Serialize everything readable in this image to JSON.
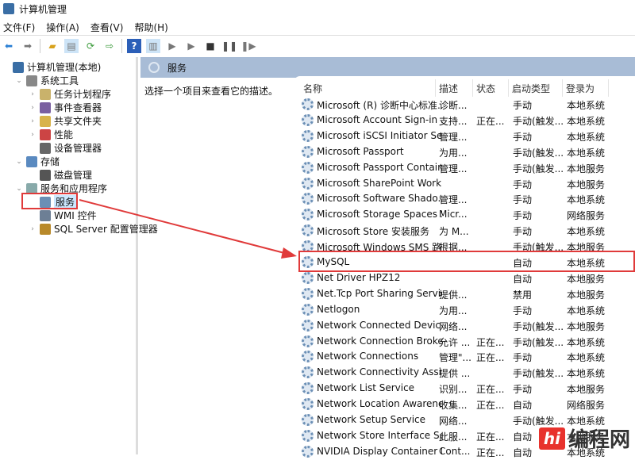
{
  "window": {
    "title": "计算机管理"
  },
  "menu": [
    "文件(F)",
    "操作(A)",
    "查看(V)",
    "帮助(H)"
  ],
  "tree": [
    {
      "label": "计算机管理(本地)",
      "level": 0,
      "expander": "",
      "icon": "computer-icon"
    },
    {
      "label": "系统工具",
      "level": 1,
      "expander": "⌄",
      "icon": "tools-icon"
    },
    {
      "label": "任务计划程序",
      "level": 2,
      "expander": "›",
      "icon": "clock-icon"
    },
    {
      "label": "事件查看器",
      "level": 2,
      "expander": "›",
      "icon": "event-viewer-icon"
    },
    {
      "label": "共享文件夹",
      "level": 2,
      "expander": "›",
      "icon": "shared-folder-icon"
    },
    {
      "label": "性能",
      "level": 2,
      "expander": "›",
      "icon": "performance-icon"
    },
    {
      "label": "设备管理器",
      "level": 2,
      "expander": "",
      "icon": "device-manager-icon"
    },
    {
      "label": "存储",
      "level": 1,
      "expander": "⌄",
      "icon": "storage-icon"
    },
    {
      "label": "磁盘管理",
      "level": 2,
      "expander": "",
      "icon": "disk-icon"
    },
    {
      "label": "服务和应用程序",
      "level": 1,
      "expander": "⌄",
      "icon": "services-apps-icon"
    },
    {
      "label": "服务",
      "level": 2,
      "expander": "",
      "icon": "gear-icon",
      "selected": true
    },
    {
      "label": "WMI 控件",
      "level": 2,
      "expander": "",
      "icon": "wmi-icon"
    },
    {
      "label": "SQL Server 配置管理器",
      "level": 2,
      "expander": "›",
      "icon": "sql-server-icon"
    }
  ],
  "pane": {
    "title": "服务",
    "description": "选择一个项目来查看它的描述。"
  },
  "columns": [
    "名称",
    "描述",
    "状态",
    "启动类型",
    "登录为"
  ],
  "services": [
    [
      "Microsoft (R) 诊断中心标准...",
      "诊断...",
      "",
      "手动",
      "本地系统"
    ],
    [
      "Microsoft Account Sign-in ...",
      "支持...",
      "正在...",
      "手动(触发...",
      "本地系统"
    ],
    [
      "Microsoft iSCSI Initiator Ser...",
      "管理...",
      "",
      "手动",
      "本地系统"
    ],
    [
      "Microsoft Passport",
      "为用...",
      "",
      "手动(触发...",
      "本地系统"
    ],
    [
      "Microsoft Passport Container",
      "管理...",
      "",
      "手动(触发...",
      "本地服务"
    ],
    [
      "Microsoft SharePoint Work...",
      "",
      "",
      "手动",
      "本地服务"
    ],
    [
      "Microsoft Software Shado...",
      "管理...",
      "",
      "手动",
      "本地系统"
    ],
    [
      "Microsoft Storage Spaces S...",
      "Micr...",
      "",
      "手动",
      "网络服务"
    ],
    [
      "Microsoft Store 安装服务",
      "为 M...",
      "",
      "手动",
      "本地系统"
    ],
    [
      "Microsoft Windows SMS 路...",
      "根据...",
      "",
      "手动(触发...",
      "本地服务"
    ],
    [
      "MySQL",
      "",
      "",
      "自动",
      "本地系统"
    ],
    [
      "Net Driver HPZ12",
      "",
      "",
      "自动",
      "本地服务"
    ],
    [
      "Net.Tcp Port Sharing Service",
      "提供...",
      "",
      "禁用",
      "本地服务"
    ],
    [
      "Netlogon",
      "为用...",
      "",
      "手动",
      "本地系统"
    ],
    [
      "Network Connected Devic...",
      "网络...",
      "",
      "手动(触发...",
      "本地服务"
    ],
    [
      "Network Connection Broker",
      "允许 ...",
      "正在...",
      "手动(触发...",
      "本地系统"
    ],
    [
      "Network Connections",
      "管理\"...",
      "正在...",
      "手动",
      "本地系统"
    ],
    [
      "Network Connectivity Assis...",
      "提供 ...",
      "",
      "手动(触发...",
      "本地系统"
    ],
    [
      "Network List Service",
      "识别...",
      "正在...",
      "手动",
      "本地服务"
    ],
    [
      "Network Location Awarene...",
      "收集...",
      "正在...",
      "自动",
      "网络服务"
    ],
    [
      "Network Setup Service",
      "网络...",
      "",
      "手动(触发...",
      "本地系统"
    ],
    [
      "Network Store Interface Se...",
      "此服...",
      "正在...",
      "自动",
      "本地服务"
    ],
    [
      "NVIDIA Display Container LS",
      "Cont...",
      "正在...",
      "自动",
      "本地系统"
    ]
  ],
  "highlight_color": "#e03a3a",
  "watermark": {
    "text": "编程网",
    "badge": "hi"
  }
}
